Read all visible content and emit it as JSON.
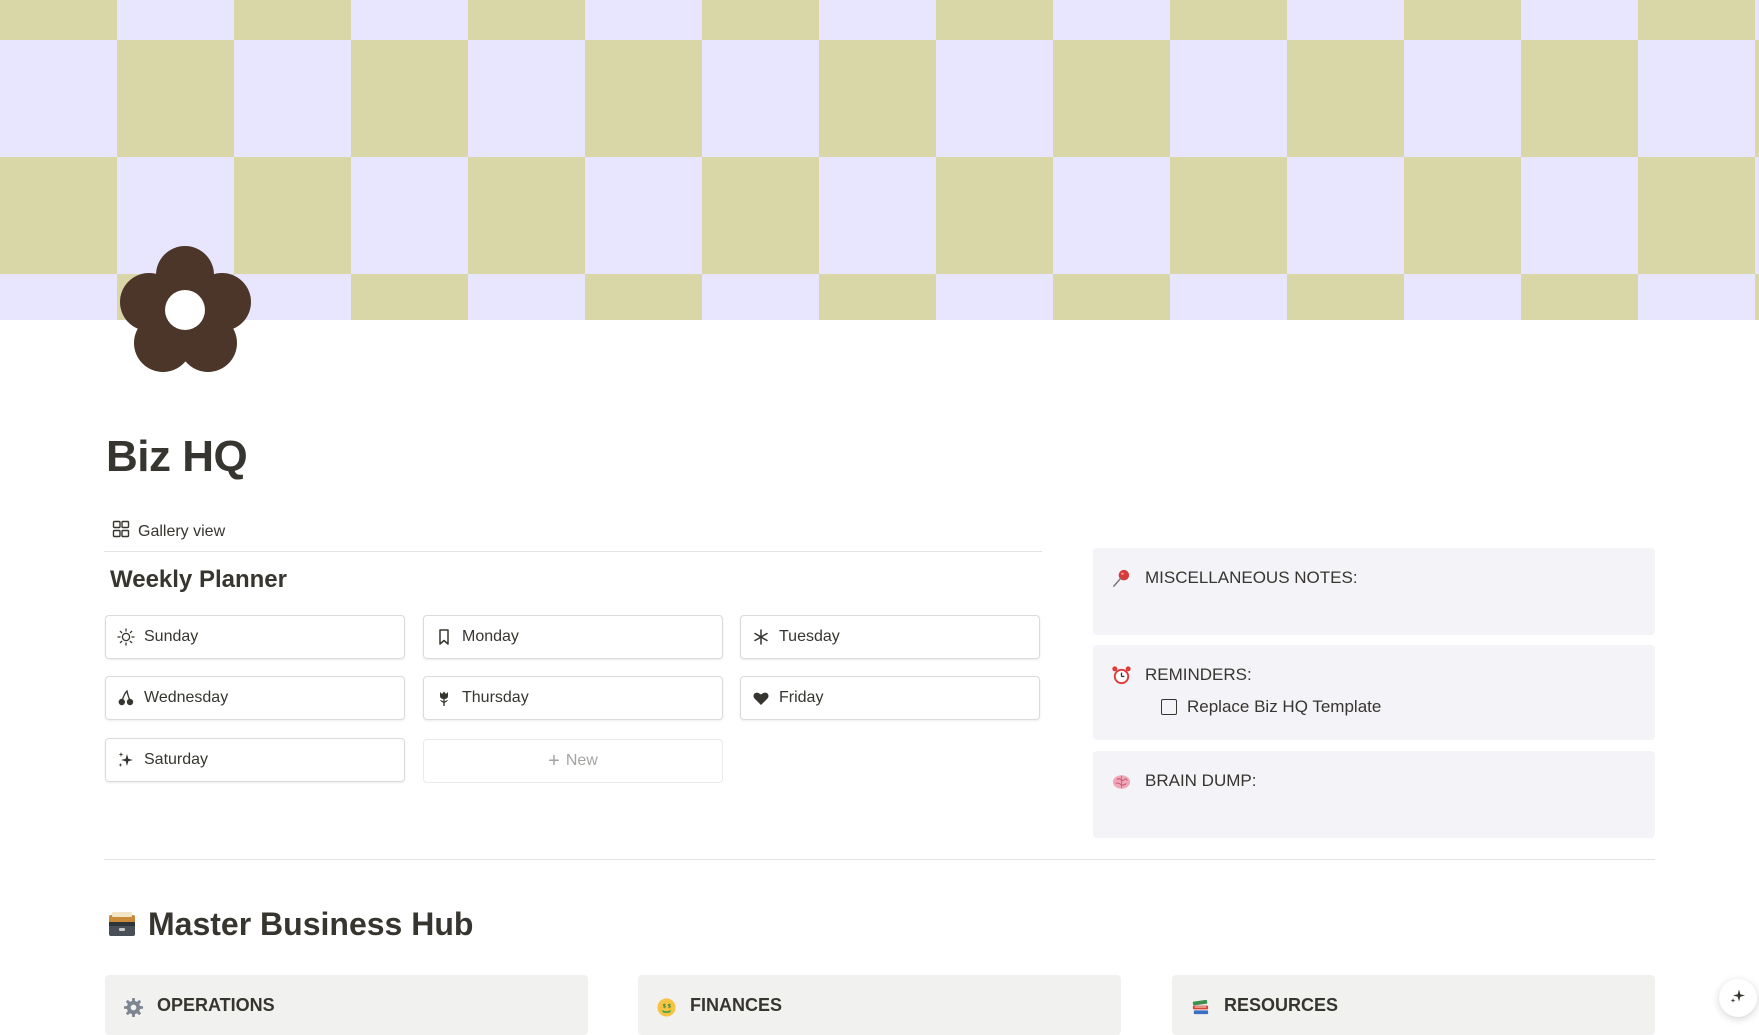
{
  "page": {
    "title": "Biz HQ",
    "icon": "flower-icon"
  },
  "cover": {
    "pattern": "checkerboard",
    "colors": [
      "#d9d6a8",
      "#e8e6fe"
    ]
  },
  "database": {
    "view_label": "Gallery view",
    "title": "Weekly Planner",
    "cards": [
      {
        "label": "Sunday",
        "icon": "sun-icon"
      },
      {
        "label": "Monday",
        "icon": "bookmark-icon"
      },
      {
        "label": "Tuesday",
        "icon": "asterisk-icon"
      },
      {
        "label": "Wednesday",
        "icon": "cherries-icon"
      },
      {
        "label": "Thursday",
        "icon": "tulip-icon"
      },
      {
        "label": "Friday",
        "icon": "heart-icon"
      },
      {
        "label": "Saturday",
        "icon": "sparkles-icon"
      }
    ],
    "new_label": "New"
  },
  "callouts": [
    {
      "label": "MISCELLANEOUS NOTES:",
      "icon": "pushpin-icon"
    },
    {
      "label": "REMINDERS:",
      "icon": "alarm-clock-icon",
      "todos": [
        {
          "text": "Replace Biz HQ Template",
          "checked": false
        }
      ]
    },
    {
      "label": "BRAIN DUMP:",
      "icon": "brain-icon"
    }
  ],
  "hub": {
    "title": "Master Business Hub",
    "icon": "card-file-box-icon",
    "sections": [
      {
        "label": "OPERATIONS",
        "icon": "gear-icon"
      },
      {
        "label": "FINANCES",
        "icon": "money-mouth-face-icon"
      },
      {
        "label": "RESOURCES",
        "icon": "books-icon"
      }
    ]
  },
  "colors": {
    "text": "#37352f",
    "callout_bg": "#f4f3f8",
    "hub_card_bg": "#f1f1ef",
    "flower": "#4b3629"
  }
}
